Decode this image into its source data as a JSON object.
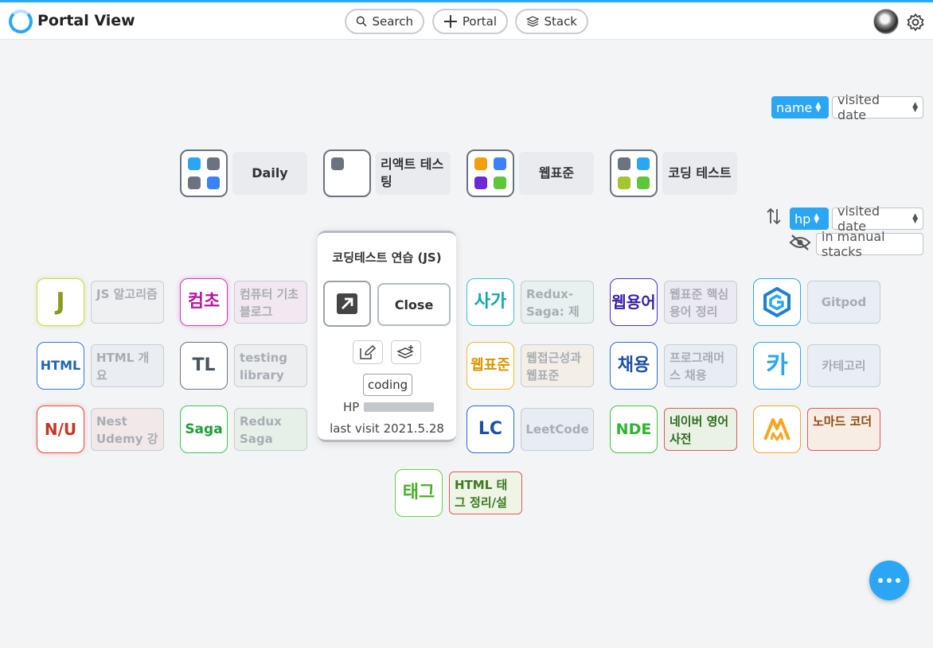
{
  "app": {
    "title": "Portal View",
    "accent": "#2aa6f5"
  },
  "header": {
    "search_label": "Search",
    "portal_label": "Portal",
    "stack_label": "Stack"
  },
  "stack_sort": {
    "active": "name",
    "other": "visited date"
  },
  "portal_sort": {
    "active": "hp",
    "other": "visited date",
    "filter": "in manual stacks"
  },
  "stacks": [
    {
      "label": "Daily",
      "colors": [
        "#2aa6f5",
        "#6b7280",
        "#6b7280",
        "#3b82f6"
      ]
    },
    {
      "label": "리액트 테스팅",
      "colors": [
        "#6b7280"
      ]
    },
    {
      "label": "웹표준",
      "colors": [
        "#f59e0b",
        "#3b82f6",
        "#6d28d9",
        "#5ec639"
      ]
    },
    {
      "label": "코딩 테스트",
      "colors": [
        "#6b7280",
        "#2aa6f5",
        "#a3c62d",
        "#5ec639"
      ]
    }
  ],
  "portals": [
    {
      "icon": "J",
      "label": "JS 알고리즘",
      "color": "#8a9a1b"
    },
    {
      "icon": "컴초",
      "label": "컴퓨터 기초 블로그",
      "color": "#b5179e"
    },
    {
      "icon": "사가",
      "label": "Redux-Saga: 제너",
      "color": "#14a6a8"
    },
    {
      "icon": "웹용어",
      "label": "웹표준 핵심 용어 정리",
      "color": "#3b1fa8"
    },
    {
      "icon": "",
      "label": "Gitpod",
      "color": "#2aa6f5"
    },
    {
      "icon": "HTML",
      "label": "HTML 개요",
      "color": "#1e63b5"
    },
    {
      "icon": "TL",
      "label": "testing library",
      "color": "#4b5563"
    },
    {
      "icon": "웹표준",
      "label": "웹접근성과 웹표준",
      "color": "#d99400"
    },
    {
      "icon": "채용",
      "label": "프로그래머스 채용",
      "color": "#1e4fa8"
    },
    {
      "icon": "카",
      "label": "카테고리",
      "color": "#2aa6f5"
    },
    {
      "icon": "N/U",
      "label": "Nest Udemy 강",
      "color": "#c0392b"
    },
    {
      "icon": "Saga",
      "label": "Redux Saga",
      "color": "#1e9e3a"
    },
    {
      "icon": "LC",
      "label": "LeetCode",
      "color": "#1e4fa8"
    },
    {
      "icon": "NDE",
      "label": "네이버 영어사전",
      "color": "#2fb52f"
    },
    {
      "icon": "",
      "label": "노마드 코더",
      "color": "#f5a623"
    },
    {
      "icon": "태그",
      "label": "HTML 태그 정리/설",
      "color": "#5ec639"
    }
  ],
  "popup": {
    "title": "코딩테스트 연습 (JS)",
    "close_label": "Close",
    "tag": "coding",
    "hp_label": "HP",
    "last_visit": "last visit 2021.5.28"
  }
}
